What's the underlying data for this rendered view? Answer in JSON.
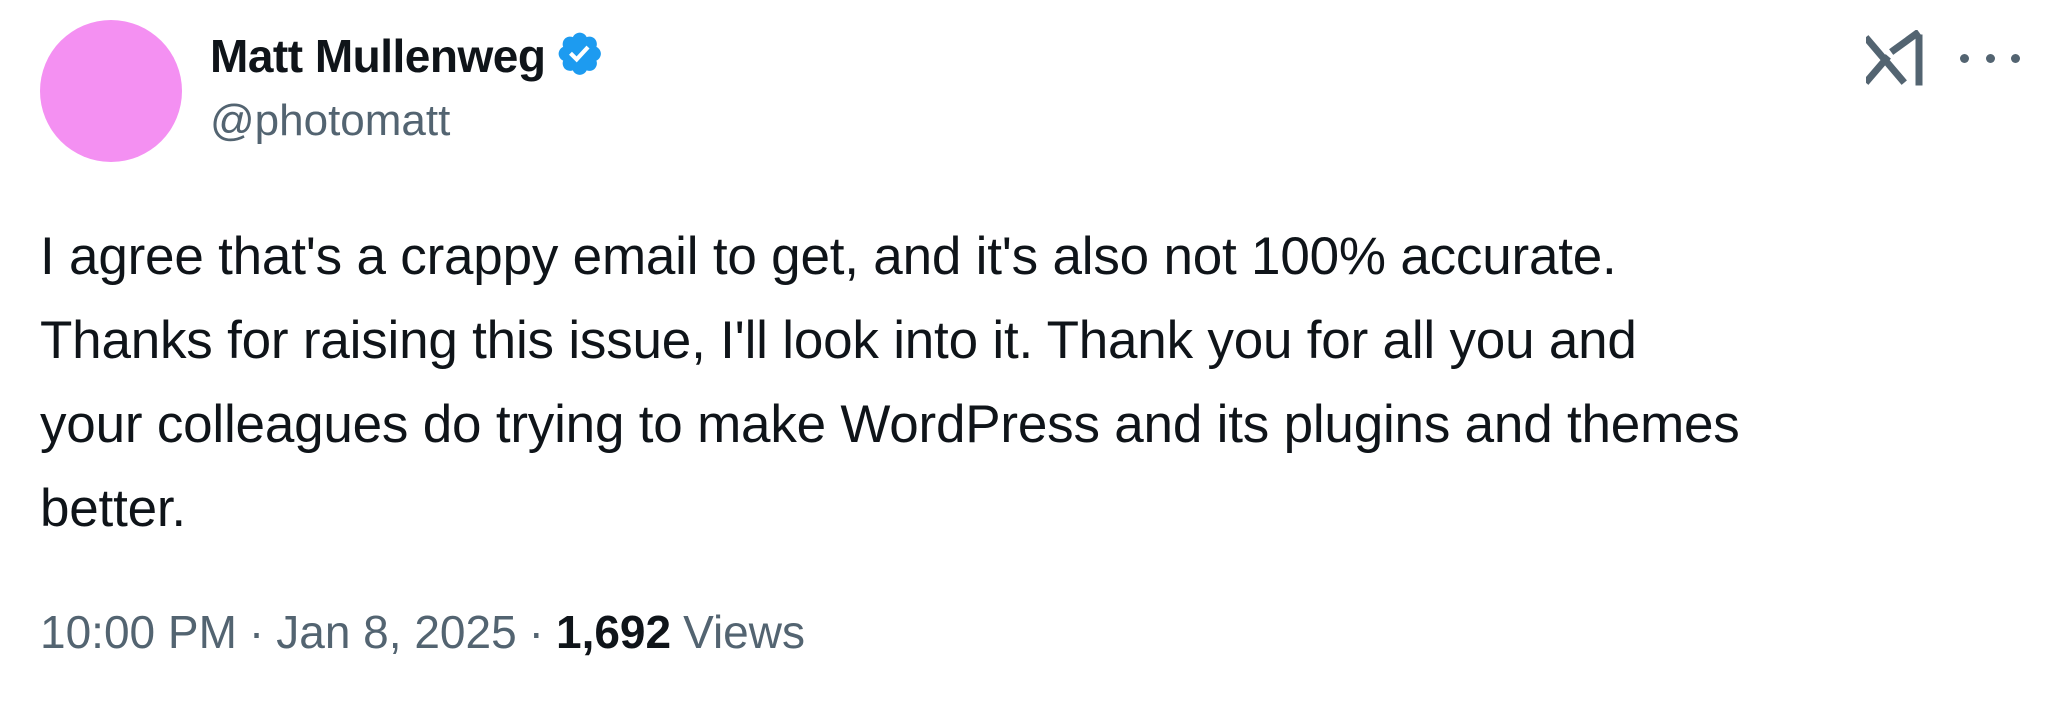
{
  "tweet": {
    "author": {
      "display_name": "Matt Mullenweg",
      "handle": "@photomatt",
      "verified": true,
      "avatar_color": "#f490f2"
    },
    "text": "I agree that's a crappy email to get, and it's also not 100% accurate.\nThanks for raising this issue, I'll look into it. Thank you for all you and\nyour colleagues do trying to make WordPress and its plugins and themes\nbetter.",
    "time": "10:00 PM",
    "date": "Jan 8, 2025",
    "separator": "·",
    "views_count": "1,692",
    "views_label": "Views"
  },
  "icons": {
    "verified": "verified-badge-icon",
    "grok": "grok-icon",
    "more": "more-options-icon"
  },
  "colors": {
    "text_primary": "#0f1419",
    "text_secondary": "#536471",
    "verified_blue": "#1d9bf0"
  }
}
